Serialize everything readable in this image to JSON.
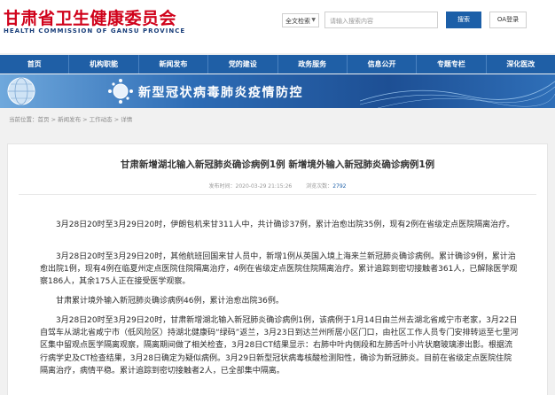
{
  "header": {
    "title": "甘肃省卫生健康委员会",
    "subtitle": "HEALTH COMMISSION OF GANSU PROVINCE",
    "scope_select": "全文检索",
    "search_placeholder": "请输入搜索内容",
    "search_button": "搜索",
    "oa_button": "OA登录"
  },
  "nav": {
    "items": [
      "首页",
      "机构职能",
      "新闻发布",
      "党的建设",
      "政务服务",
      "信息公开",
      "专题专栏",
      "深化医改"
    ]
  },
  "banner": {
    "title": "新型冠状病毒肺炎疫情防控"
  },
  "breadcrumb": "当前位置：首页 > 新闻发布 > 工作动态 > 详情",
  "article": {
    "title": "甘肃新增湖北输入新冠肺炎确诊病例1例 新增境外输入新冠肺炎确诊病例1例",
    "published": "发布时间：2020-03-29 21:15:26",
    "views_label": "浏览次数：",
    "views": "2792",
    "paragraphs": [
      "3月28日20时至3月29日20时，伊朗包机来甘311人中，共计确诊37例，累计治愈出院35例，现有2例在省级定点医院隔离治疗。",
      "3月28日20时至3月29日20时，其他航班回国来甘人员中，新增1例从英国入境上海来兰新冠肺炎确诊病例。累计确诊9例，累计治愈出院1例，现有4例在临夏州定点医院住院隔离治疗，4例在省级定点医院住院隔离治疗。累计追踪到密切接触者361人，已解除医学观察186人，其余175人正在接受医学观察。",
      "甘肃累计境外输入新冠肺炎确诊病例46例，累计治愈出院36例。",
      "3月28日20时至3月29日20时，甘肃新增湖北输入新冠肺炎确诊病例1例，该病例于1月14日由兰州去湖北省咸宁市老家，3月22日自驾车从湖北省咸宁市（低风险区）持湖北健康码“绿码”返兰，3月23日到达兰州所居小区门口，由社区工作人员专门安排转运至七里河区集中留观点医学隔离观察，隔离期间做了相关检查，3月28日CT结果显示：右肺中叶内侧段和左肺舌叶小片状磨玻璃渗出影。根据流行病学史及CT检查结果，3月28日确定为疑似病例。3月29日新型冠状病毒核酸检测阳性，确诊为新冠肺炎。目前在省级定点医院住院隔离治疗，病情平稳。累计追踪到密切接触者2人，已全部集中隔离。"
    ]
  },
  "colors": {
    "brand_red": "#d0021b",
    "nav_blue": "#1f5fa6",
    "accent_blue": "#1c5fa8"
  }
}
